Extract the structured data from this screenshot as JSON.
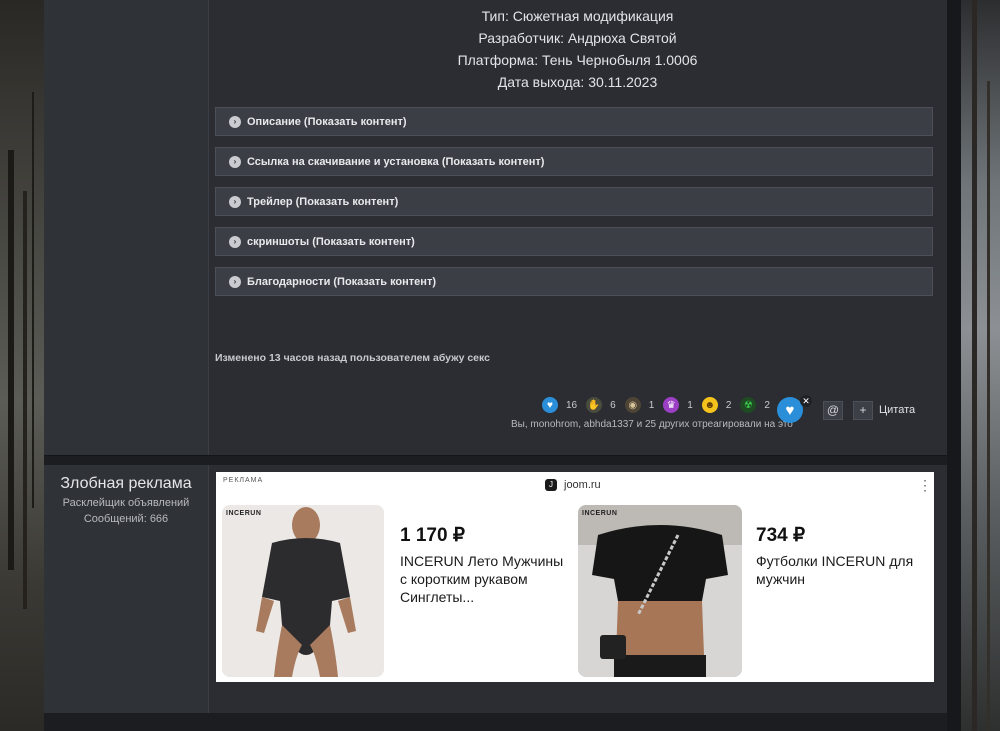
{
  "post": {
    "info": [
      "Тип: Сюжетная модификация",
      "Разработчик: Андрюха Святой",
      "Платформа: Тень Чернобыля 1.0006",
      "Дата выхода: 30.11.2023"
    ],
    "spoilers": [
      "Описание (Показать контент)",
      "Ссылка на скачивание и установка (Показать контент)",
      "Трейлер (Показать контент)",
      "скриншоты (Показать контент)",
      "Благодарности (Показать контент)"
    ],
    "edited": "Изменено 13 часов назад пользователем абужу секс",
    "reactions": [
      {
        "icon": "heart-icon",
        "count": "16",
        "color": "#2a8fd8"
      },
      {
        "icon": "thumbs-up-icon",
        "count": "6",
        "color": "#6b6e55"
      },
      {
        "icon": "eye-icon",
        "count": "1",
        "color": "#7a6a4a"
      },
      {
        "icon": "trophy-icon",
        "count": "1",
        "color": "#9b3fc4"
      },
      {
        "icon": "laugh-icon",
        "count": "2",
        "color": "#f4c21c"
      },
      {
        "icon": "radiation-icon",
        "count": "2",
        "color": "#2f9b3a"
      }
    ],
    "reacted_by": "Вы, monohrom, abhda1337 и 25 других отреагировали на это",
    "quote_label": "Цитата"
  },
  "ad_post": {
    "username": "Злобная реклама",
    "user_title": "Расклейщик объявлений",
    "message_count": "Сообщений: 666",
    "ad": {
      "label": "РЕКЛАМА",
      "domain": "joom.ru",
      "products": [
        {
          "brand": "INCERUN",
          "price": "1 170 ₽",
          "title": "INCERUN Лето Мужчины с коротким рукавом Синглеты..."
        },
        {
          "brand": "INCERUN",
          "price": "734 ₽",
          "title": "Футболки INCERUN для мужчин"
        }
      ]
    }
  }
}
